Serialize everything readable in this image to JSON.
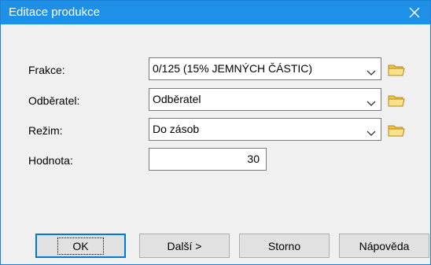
{
  "window": {
    "title": "Editace produkce"
  },
  "form": {
    "frakce": {
      "label": "Frakce:",
      "value": "0/125 (15% JEMNÝCH ČÁSTIC)"
    },
    "odberatel": {
      "label": "Odběratel:",
      "value": "Odběratel"
    },
    "rezim": {
      "label": "Režim:",
      "value": "Do zásob"
    },
    "hodnota": {
      "label": "Hodnota:",
      "value": "30"
    }
  },
  "buttons": {
    "ok": "OK",
    "next": "Další >",
    "cancel": "Storno",
    "help": "Nápověda"
  },
  "colors": {
    "titlebar": "#1e90e8",
    "folder": "#f5c542"
  }
}
